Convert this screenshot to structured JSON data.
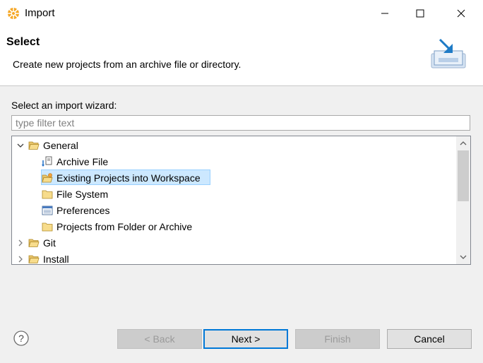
{
  "window": {
    "title": "Import"
  },
  "banner": {
    "title": "Select",
    "description": "Create new projects from an archive file or directory."
  },
  "wizard": {
    "label": "Select an import wizard:",
    "filter_placeholder": "type filter text",
    "filter_value": ""
  },
  "tree": {
    "general": "General",
    "archive_file": "Archive File",
    "existing_projects": "Existing Projects into Workspace",
    "file_system": "File System",
    "preferences": "Preferences",
    "projects_from_folder": "Projects from Folder or Archive",
    "git": "Git",
    "install": "Install",
    "selected": "Existing Projects into Workspace"
  },
  "buttons": {
    "back": "< Back",
    "next": "Next >",
    "finish": "Finish",
    "cancel": "Cancel"
  },
  "colors": {
    "selection": "#cce8ff",
    "default_button_border": "#0078d7"
  },
  "icons": {
    "app": "eclipse-icon",
    "banner": "import-icon",
    "help": "help-icon"
  }
}
